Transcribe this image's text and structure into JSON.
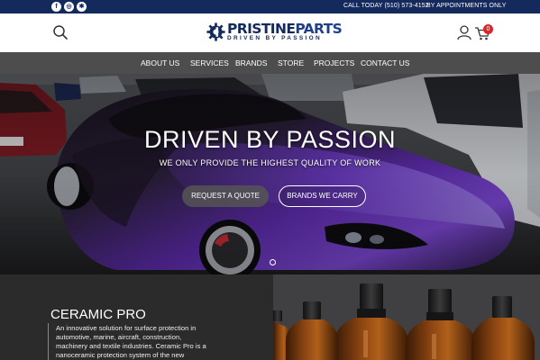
{
  "topbar": {
    "social": [
      {
        "name": "facebook-icon",
        "glyph": "f"
      },
      {
        "name": "instagram-icon",
        "glyph": "◎"
      },
      {
        "name": "yelp-icon",
        "glyph": "✱"
      }
    ],
    "phone": "CALL TODAY (510) 573-4152",
    "appointments": "BY APPOINTMENTS ONLY"
  },
  "header": {
    "logo_name_1": "PRISTINE",
    "logo_name_2": "PARTS",
    "logo_tagline": "DRIVEN BY PASSION",
    "cart_count": "0",
    "icons": [
      "search-icon",
      "user-icon",
      "cart-icon"
    ]
  },
  "nav": {
    "items": [
      "ABOUT US",
      "SERVICES",
      "BRANDS",
      "STORE",
      "PROJECTS",
      "CONTACT US"
    ]
  },
  "hero": {
    "title": "DRIVEN BY PASSION",
    "subtitle": "WE ONLY PROVIDE THE HIGHEST QUALITY OF WORK",
    "cta_quote": "REQUEST A QUOTE",
    "cta_brands": "BRANDS WE CARRY"
  },
  "feature": {
    "title": "CERAMIC PRO",
    "line1": "An innovative solution for surface protection in",
    "line2": "automotive, marine, aircraft, construction,",
    "line3": "machinery and textile industries. Ceramic Pro is a",
    "line4": "nanoceramic protection system of the new"
  },
  "colors": {
    "topbar": "#142a5c",
    "nav": "#4d4d4d",
    "accent_badge": "#d9262a",
    "car_purple": "#5b2aa8"
  }
}
